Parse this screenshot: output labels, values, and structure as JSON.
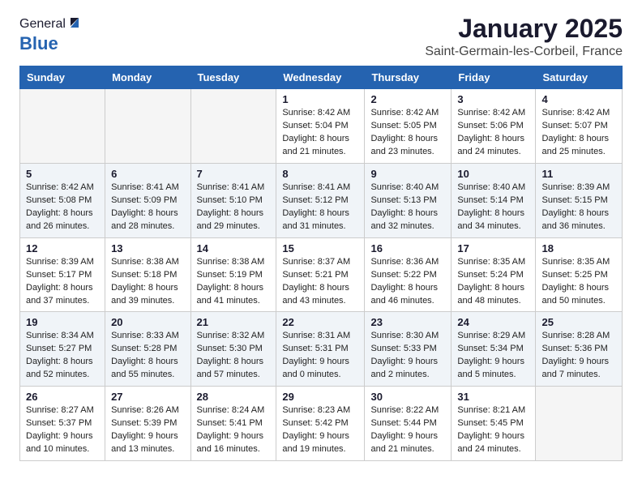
{
  "header": {
    "logo_general": "General",
    "logo_blue": "Blue",
    "title": "January 2025",
    "subtitle": "Saint-Germain-les-Corbeil, France"
  },
  "weekdays": [
    "Sunday",
    "Monday",
    "Tuesday",
    "Wednesday",
    "Thursday",
    "Friday",
    "Saturday"
  ],
  "weeks": [
    [
      {
        "day": "",
        "info": ""
      },
      {
        "day": "",
        "info": ""
      },
      {
        "day": "",
        "info": ""
      },
      {
        "day": "1",
        "info": "Sunrise: 8:42 AM\nSunset: 5:04 PM\nDaylight: 8 hours\nand 21 minutes."
      },
      {
        "day": "2",
        "info": "Sunrise: 8:42 AM\nSunset: 5:05 PM\nDaylight: 8 hours\nand 23 minutes."
      },
      {
        "day": "3",
        "info": "Sunrise: 8:42 AM\nSunset: 5:06 PM\nDaylight: 8 hours\nand 24 minutes."
      },
      {
        "day": "4",
        "info": "Sunrise: 8:42 AM\nSunset: 5:07 PM\nDaylight: 8 hours\nand 25 minutes."
      }
    ],
    [
      {
        "day": "5",
        "info": "Sunrise: 8:42 AM\nSunset: 5:08 PM\nDaylight: 8 hours\nand 26 minutes."
      },
      {
        "day": "6",
        "info": "Sunrise: 8:41 AM\nSunset: 5:09 PM\nDaylight: 8 hours\nand 28 minutes."
      },
      {
        "day": "7",
        "info": "Sunrise: 8:41 AM\nSunset: 5:10 PM\nDaylight: 8 hours\nand 29 minutes."
      },
      {
        "day": "8",
        "info": "Sunrise: 8:41 AM\nSunset: 5:12 PM\nDaylight: 8 hours\nand 31 minutes."
      },
      {
        "day": "9",
        "info": "Sunrise: 8:40 AM\nSunset: 5:13 PM\nDaylight: 8 hours\nand 32 minutes."
      },
      {
        "day": "10",
        "info": "Sunrise: 8:40 AM\nSunset: 5:14 PM\nDaylight: 8 hours\nand 34 minutes."
      },
      {
        "day": "11",
        "info": "Sunrise: 8:39 AM\nSunset: 5:15 PM\nDaylight: 8 hours\nand 36 minutes."
      }
    ],
    [
      {
        "day": "12",
        "info": "Sunrise: 8:39 AM\nSunset: 5:17 PM\nDaylight: 8 hours\nand 37 minutes."
      },
      {
        "day": "13",
        "info": "Sunrise: 8:38 AM\nSunset: 5:18 PM\nDaylight: 8 hours\nand 39 minutes."
      },
      {
        "day": "14",
        "info": "Sunrise: 8:38 AM\nSunset: 5:19 PM\nDaylight: 8 hours\nand 41 minutes."
      },
      {
        "day": "15",
        "info": "Sunrise: 8:37 AM\nSunset: 5:21 PM\nDaylight: 8 hours\nand 43 minutes."
      },
      {
        "day": "16",
        "info": "Sunrise: 8:36 AM\nSunset: 5:22 PM\nDaylight: 8 hours\nand 46 minutes."
      },
      {
        "day": "17",
        "info": "Sunrise: 8:35 AM\nSunset: 5:24 PM\nDaylight: 8 hours\nand 48 minutes."
      },
      {
        "day": "18",
        "info": "Sunrise: 8:35 AM\nSunset: 5:25 PM\nDaylight: 8 hours\nand 50 minutes."
      }
    ],
    [
      {
        "day": "19",
        "info": "Sunrise: 8:34 AM\nSunset: 5:27 PM\nDaylight: 8 hours\nand 52 minutes."
      },
      {
        "day": "20",
        "info": "Sunrise: 8:33 AM\nSunset: 5:28 PM\nDaylight: 8 hours\nand 55 minutes."
      },
      {
        "day": "21",
        "info": "Sunrise: 8:32 AM\nSunset: 5:30 PM\nDaylight: 8 hours\nand 57 minutes."
      },
      {
        "day": "22",
        "info": "Sunrise: 8:31 AM\nSunset: 5:31 PM\nDaylight: 9 hours\nand 0 minutes."
      },
      {
        "day": "23",
        "info": "Sunrise: 8:30 AM\nSunset: 5:33 PM\nDaylight: 9 hours\nand 2 minutes."
      },
      {
        "day": "24",
        "info": "Sunrise: 8:29 AM\nSunset: 5:34 PM\nDaylight: 9 hours\nand 5 minutes."
      },
      {
        "day": "25",
        "info": "Sunrise: 8:28 AM\nSunset: 5:36 PM\nDaylight: 9 hours\nand 7 minutes."
      }
    ],
    [
      {
        "day": "26",
        "info": "Sunrise: 8:27 AM\nSunset: 5:37 PM\nDaylight: 9 hours\nand 10 minutes."
      },
      {
        "day": "27",
        "info": "Sunrise: 8:26 AM\nSunset: 5:39 PM\nDaylight: 9 hours\nand 13 minutes."
      },
      {
        "day": "28",
        "info": "Sunrise: 8:24 AM\nSunset: 5:41 PM\nDaylight: 9 hours\nand 16 minutes."
      },
      {
        "day": "29",
        "info": "Sunrise: 8:23 AM\nSunset: 5:42 PM\nDaylight: 9 hours\nand 19 minutes."
      },
      {
        "day": "30",
        "info": "Sunrise: 8:22 AM\nSunset: 5:44 PM\nDaylight: 9 hours\nand 21 minutes."
      },
      {
        "day": "31",
        "info": "Sunrise: 8:21 AM\nSunset: 5:45 PM\nDaylight: 9 hours\nand 24 minutes."
      },
      {
        "day": "",
        "info": ""
      }
    ]
  ]
}
